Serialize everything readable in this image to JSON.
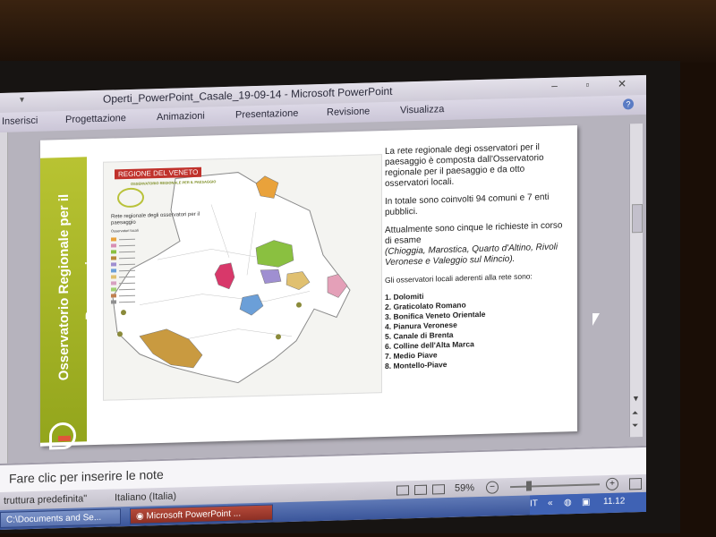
{
  "window": {
    "title": "Operti_PowerPoint_Casale_19-09-14 - Microsoft PowerPoint",
    "controls": [
      "–",
      "▫",
      "✕"
    ]
  },
  "ribbon": {
    "tabs": [
      "Inserisci",
      "Progettazione",
      "Animazioni",
      "Presentazione",
      "Revisione",
      "Visualizza"
    ]
  },
  "slide": {
    "band_title": "Osservatorio Regionale per il Paesaggio",
    "map": {
      "header": "REGIONE DEL VENETO",
      "subheader": "OSSERVATORIO REGIONALE PER IL PAESAGGIO",
      "legend_title": "Rete regionale degli osservatori per il paesaggio",
      "legend_subtitle": "Osservatori locali",
      "legend_colors": [
        "#e9a23b",
        "#d88fb4",
        "#8ac040",
        "#b88a3a",
        "#9f8fd1",
        "#6b9fd8",
        "#e0c070",
        "#d7a0c0",
        "#a0d070",
        "#c08050",
        "#909090"
      ]
    },
    "paragraphs": [
      "La rete regionale degi osservatori per il paesaggio è composta dall'Osservatorio regionale per il paesaggio e da otto osservatori locali.",
      "In totale sono coinvolti 94 comuni e 7 enti pubblici.",
      "Attualmente sono cinque le richieste in corso di esame",
      "(Chioggia, Marostica, Quarto d'Altino, Rivoli Veronese e Valeggio sul Mincio).",
      "Gli osservatori locali aderenti alla rete sono:"
    ],
    "observatories": [
      "1. Dolomiti",
      "2. Graticolato Romano",
      "3. Bonifica Veneto Orientale",
      "4. Pianura Veronese",
      "5. Canale di Brenta",
      "6. Colline dell'Alta Marca",
      "7. Medio Piave",
      "8. Montello-Piave"
    ]
  },
  "notes": {
    "placeholder": "Fare clic per inserire le note"
  },
  "status": {
    "theme": "truttura predefinita\"",
    "language": "Italiano (Italia)",
    "zoom": "59%"
  },
  "taskbar": {
    "items": [
      "C:\\Documents and Se...",
      "Microsoft PowerPoint ..."
    ],
    "lang": "IT",
    "time": "11.12"
  }
}
